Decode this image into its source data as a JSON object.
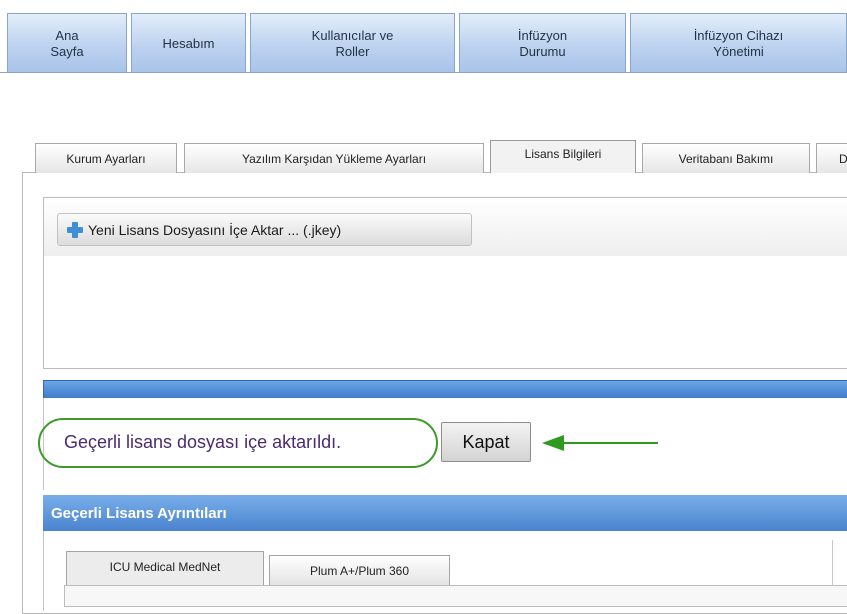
{
  "top_nav": {
    "tabs": [
      {
        "label": "Ana\nSayfa"
      },
      {
        "label": "Hesabım"
      },
      {
        "label": "Kullanıcılar ve\nRoller"
      },
      {
        "label": "İnfüzyon\nDurumu"
      },
      {
        "label": "İnfüzyon Cihazı\nYönetimi"
      }
    ]
  },
  "sub_tabs": {
    "tabs": [
      {
        "label": "Kurum Ayarları"
      },
      {
        "label": "Yazılım Karşıdan Yükleme Ayarları"
      },
      {
        "label": "Lisans Bilgileri",
        "active": true
      },
      {
        "label": "Veritabanı Bakımı"
      },
      {
        "label": "D"
      }
    ]
  },
  "import": {
    "button_label": "Yeni Lisans Dosyasını İçe Aktar ... (.jkey)"
  },
  "message": {
    "text": "Geçerli lisans dosyası içe aktarıldı.",
    "close_label": "Kapat"
  },
  "details": {
    "header": "Geçerli Lisans Ayrıntıları",
    "tabs": [
      {
        "label": "ICU Medical MedNet",
        "active": true
      },
      {
        "label": "Plum A+/Plum 360"
      }
    ]
  },
  "colors": {
    "nav_blue": "#bcd2ef",
    "header_blue": "#4a84cf",
    "highlight_green": "#3d9a2a",
    "message_purple": "#4a2b6e"
  }
}
